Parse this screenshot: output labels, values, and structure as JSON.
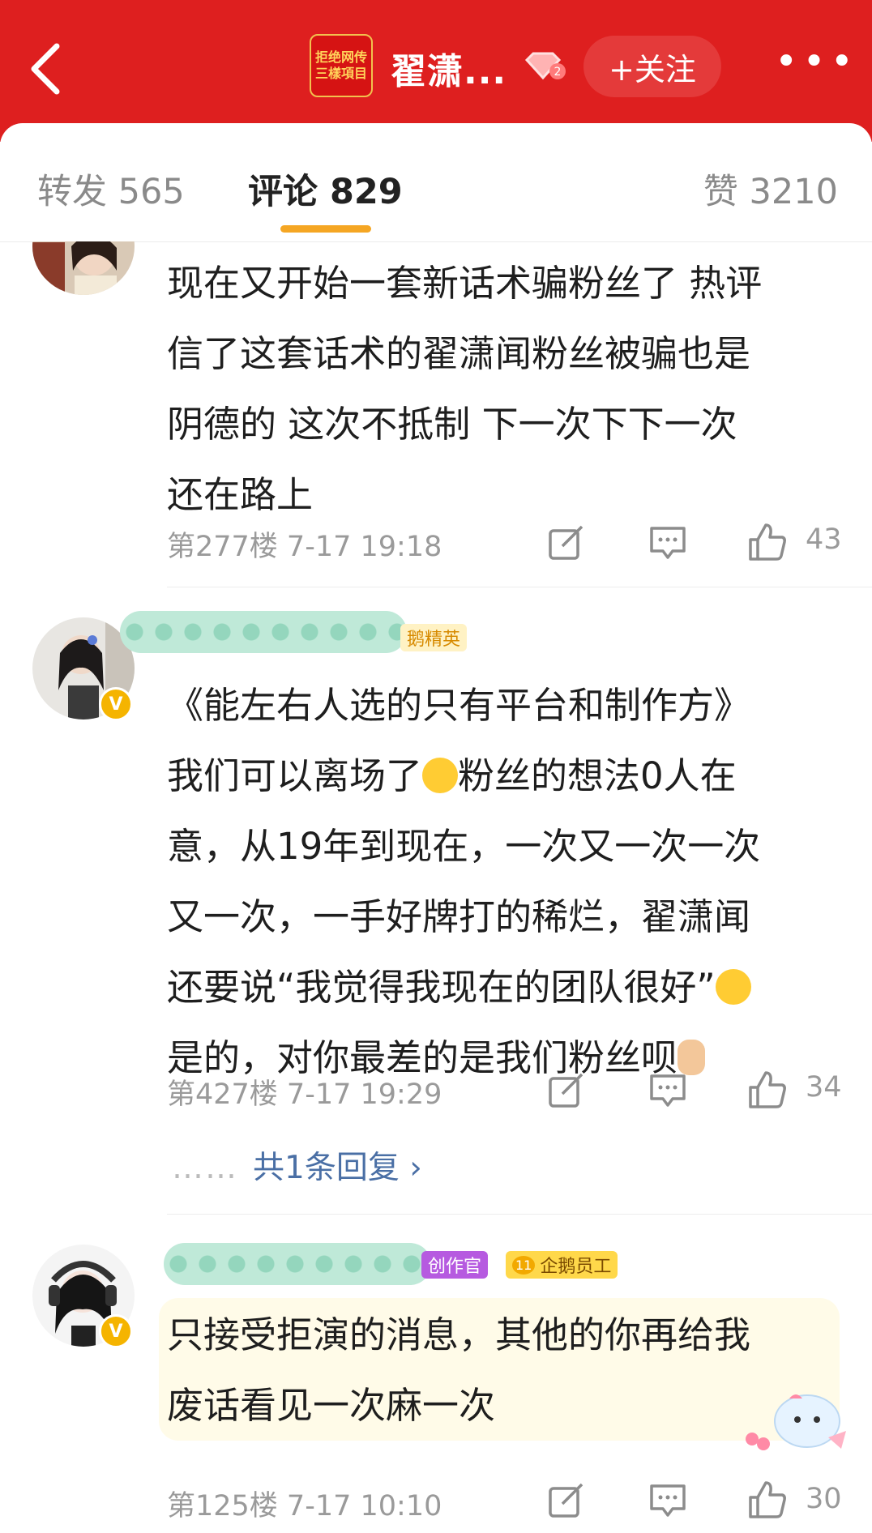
{
  "header": {
    "avatar_text_line1": "拒绝网传",
    "avatar_text_line2": "三樣項目",
    "title": "翟潇...",
    "vip_level": "2",
    "follow_label": "+关注",
    "more_label": "•••"
  },
  "tabs": {
    "repost": "转发 565",
    "comment": "评论 829",
    "like": "赞 3210"
  },
  "comments": [
    {
      "lines": [
        "现在又开始一套新话术骗粉丝了 热评",
        "信了这套话术的翟潇闻粉丝被骗也是",
        "阴德的  这次不抵制 下一次下下一次",
        "还在路上"
      ],
      "floor_time": "第277楼  7-17 19:18",
      "likes": "43"
    },
    {
      "tag": "鹅精英",
      "lines_a": [
        "《能左右人选的只有平台和制作方》"
      ],
      "line2_pre": "我们可以离场了",
      "line2_post": "粉丝的想法0人在",
      "lines_b": [
        "意，从19年到现在，一次又一次一次",
        "又一次，一手好牌打的稀烂，翟潇闻"
      ],
      "line5_pre": "还要说“我觉得我现在的团队很好”",
      "line6_pre": "是的，对你最差的是我们粉丝呗",
      "floor_time": "第427楼  7-17 19:29",
      "likes": "34",
      "replies": "共1条回复 ›"
    },
    {
      "tag1": "创作官",
      "tag2": "企鹅员工",
      "tag2_level": "11",
      "lines": [
        "只接受拒演的消息，其他的你再给我",
        "废话看见一次麻一次"
      ],
      "floor_time": "第125楼  7-17 10:10",
      "likes": "30"
    }
  ],
  "replies_dots": "……",
  "colors": {
    "header_red": "#de1f1f",
    "tab_underline": "#f5a623",
    "reply_link": "#4a6fa5",
    "meta_gray": "#9a9a9a"
  },
  "icons": [
    "back-arrow-icon",
    "vip-diamond-icon",
    "repost-icon",
    "comment-icon",
    "like-icon",
    "verified-icon"
  ]
}
